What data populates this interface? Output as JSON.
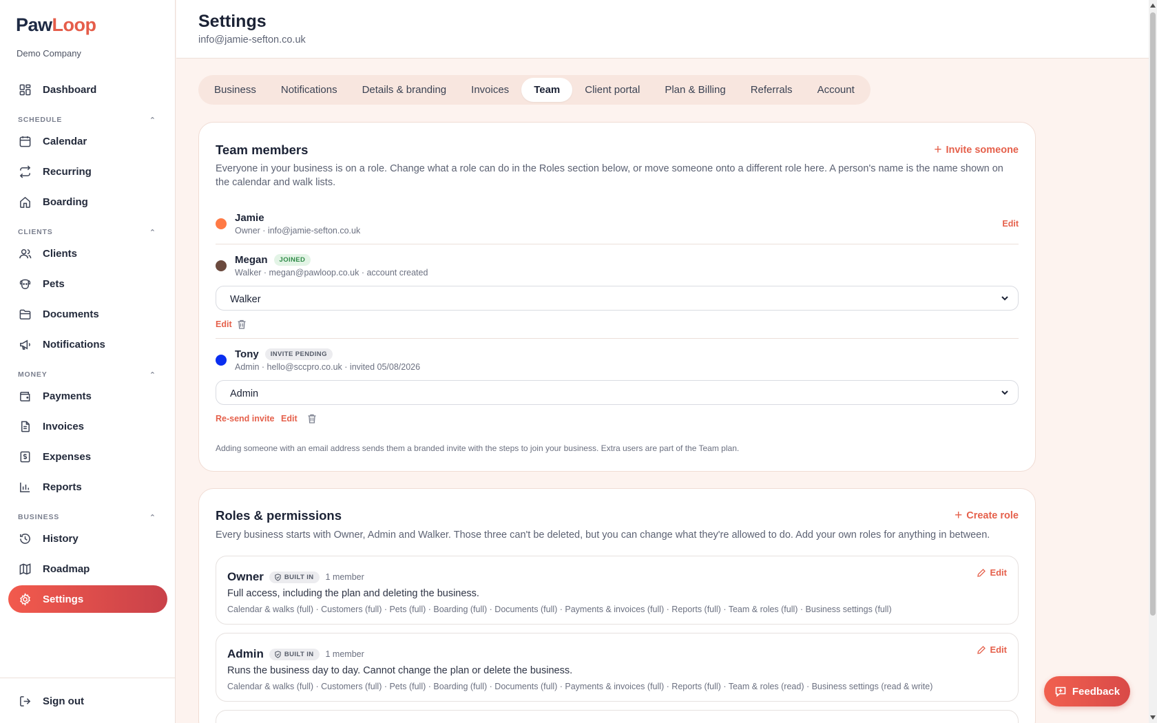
{
  "app": {
    "logo_part1": "Paw",
    "logo_part2": "Loop",
    "company": "Demo Company"
  },
  "sidebar": {
    "dashboard": "Dashboard",
    "sections": {
      "schedule": "SCHEDULE",
      "clients": "CLIENTS",
      "money": "MONEY",
      "business": "BUSINESS"
    },
    "items": {
      "calendar": "Calendar",
      "recurring": "Recurring",
      "boarding": "Boarding",
      "clients": "Clients",
      "pets": "Pets",
      "documents": "Documents",
      "notifications": "Notifications",
      "payments": "Payments",
      "invoices": "Invoices",
      "expenses": "Expenses",
      "reports": "Reports",
      "history": "History",
      "roadmap": "Roadmap",
      "settings": "Settings"
    },
    "sign_out": "Sign out"
  },
  "header": {
    "title": "Settings",
    "email": "info@jamie-sefton.co.uk"
  },
  "tabs": [
    "Business",
    "Notifications",
    "Details & branding",
    "Invoices",
    "Team",
    "Client portal",
    "Plan & Billing",
    "Referrals",
    "Account"
  ],
  "active_tab": "Team",
  "team": {
    "title": "Team members",
    "invite": "Invite someone",
    "description": "Everyone in your business is on a role. Change what a role can do in the Roles section below, or move someone onto a different role here. A person's name is the name shown on the calendar and walk lists.",
    "members": [
      {
        "name": "Jamie",
        "sub": "Owner · info@jamie-sefton.co.uk",
        "color": "#ff7a45",
        "edit": "Edit"
      },
      {
        "name": "Megan",
        "badge": "JOINED",
        "sub": "Walker · megan@pawloop.co.uk · account created",
        "color": "#6b4a3e",
        "role": "Walker",
        "edit": "Edit"
      },
      {
        "name": "Tony",
        "badge": "INVITE PENDING",
        "sub": "Admin · hello@sccpro.co.uk · invited 05/08/2026",
        "color": "#0a2ef0",
        "role": "Admin",
        "resend": "Re-send invite",
        "edit": "Edit"
      }
    ],
    "footnote": "Adding someone with an email address sends them a branded invite with the steps to join your business. Extra users are part of the Team plan."
  },
  "roles": {
    "title": "Roles & permissions",
    "create": "Create role",
    "description": "Every business starts with Owner, Admin and Walker. Those three can't be deleted, but you can change what they're allowed to do. Add your own roles for anything in between.",
    "items": [
      {
        "name": "Owner",
        "badge": "BUILT IN",
        "count": "1 member",
        "edit": "Edit",
        "desc": "Full access, including the plan and deleting the business.",
        "perms": "Calendar & walks (full) · Customers (full) · Pets (full) · Boarding (full) · Documents (full) · Payments & invoices (full) · Reports (full) · Team & roles (full) · Business settings (full)"
      },
      {
        "name": "Admin",
        "badge": "BUILT IN",
        "count": "1 member",
        "edit": "Edit",
        "desc": "Runs the business day to day. Cannot change the plan or delete the business.",
        "perms": "Calendar & walks (full) · Customers (full) · Pets (full) · Boarding (full) · Documents (full) · Payments & invoices (full) · Reports (full) · Team & roles (read) · Business settings (read & write)"
      }
    ]
  },
  "feedback": "Feedback",
  "colors": {
    "accent": "#e5604b",
    "brand_dark": "#1e2a44",
    "background": "#fdf3ef"
  }
}
